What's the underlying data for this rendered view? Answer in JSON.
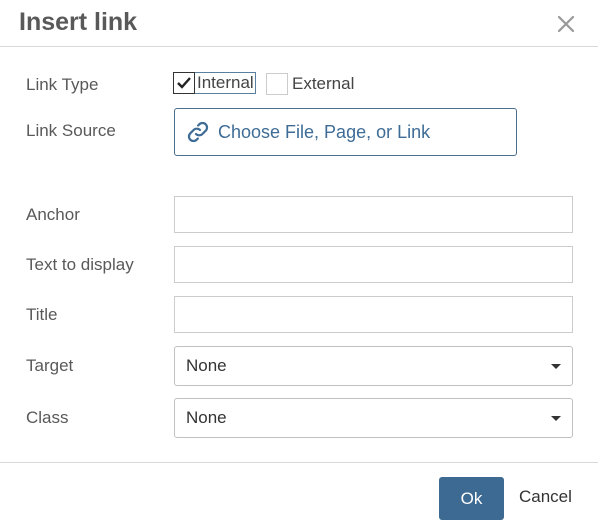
{
  "dialog": {
    "title": "Insert link",
    "close_icon": "close-icon"
  },
  "link_type": {
    "label": "Link Type",
    "options": [
      {
        "label": "Internal",
        "checked": true
      },
      {
        "label": "External",
        "checked": false
      }
    ]
  },
  "link_source": {
    "label": "Link Source",
    "button_label": "Choose File, Page, or Link",
    "icon": "link-icon"
  },
  "fields": {
    "anchor": {
      "label": "Anchor",
      "value": ""
    },
    "text_to_display": {
      "label": "Text to display",
      "value": ""
    },
    "title": {
      "label": "Title",
      "value": ""
    },
    "target": {
      "label": "Target",
      "value": "None"
    },
    "class": {
      "label": "Class",
      "value": "None"
    }
  },
  "footer": {
    "ok_label": "Ok",
    "cancel_label": "Cancel"
  },
  "colors": {
    "accent": "#3d6a93",
    "link_text": "#3e6c96"
  }
}
